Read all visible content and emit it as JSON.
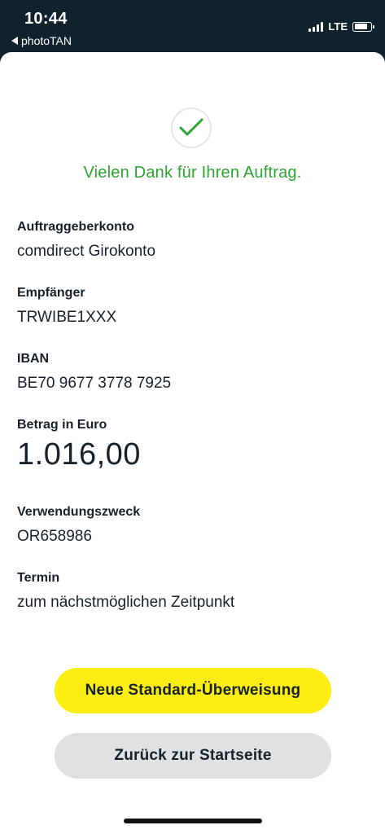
{
  "status_bar": {
    "time": "10:44",
    "back_app": "photoTAN",
    "network": "LTE",
    "signal_bars": 4,
    "battery_level": 0.85
  },
  "confirmation": {
    "message": "Vielen Dank für Ihren Auftrag.",
    "icon": "checkmark-icon",
    "accent_color": "#2aa52f"
  },
  "details": {
    "sender_account_label": "Auftraggeberkonto",
    "sender_account_value": "comdirect Girokonto",
    "recipient_label": "Empfänger",
    "recipient_value": "TRWIBE1XXX",
    "iban_label": "IBAN",
    "iban_value": "BE70 9677 3778 7925",
    "amount_label": "Betrag in Euro",
    "amount_value": "1.016,00",
    "purpose_label": "Verwendungszweck",
    "purpose_value": "OR658986",
    "date_label": "Termin",
    "date_value": "zum nächstmöglichen Zeitpunkt"
  },
  "actions": {
    "new_transfer_label": "Neue Standard-Überweisung",
    "back_home_label": "Zurück zur Startseite",
    "primary_color": "#fcee12",
    "secondary_color": "#dfe1e3"
  }
}
